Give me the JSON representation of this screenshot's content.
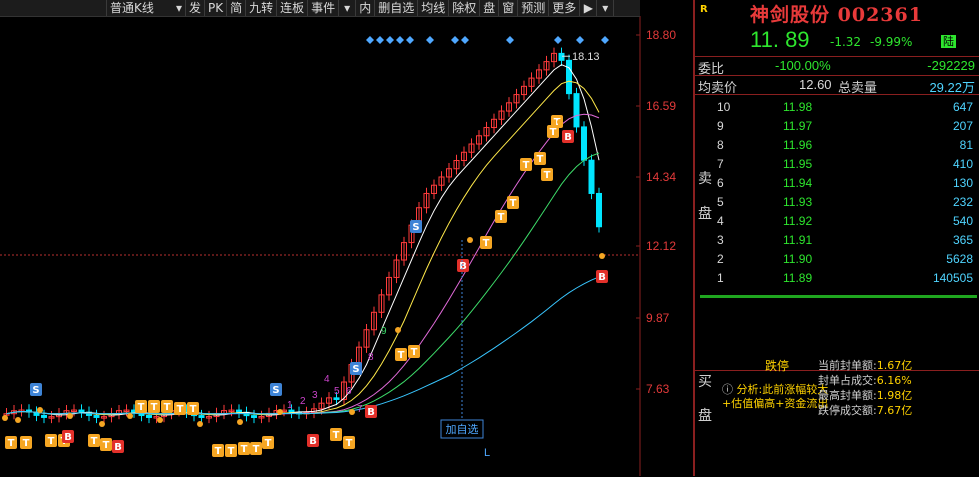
{
  "toolbar": {
    "items": [
      "普通K线",
      "发",
      "PK",
      "简",
      "九转",
      "连板",
      "事件",
      "内",
      "删自选",
      "均线",
      "除权",
      "盘",
      "窗",
      "预测",
      "更多"
    ]
  },
  "chart": {
    "y_axis_labels": [
      "18.80",
      "16.59",
      "14.34",
      "12.12",
      "9.87",
      "7.63"
    ],
    "peak_label": "18.13",
    "add_watchlist_label": "加自选",
    "l_marker": "L",
    "count_labels": [
      "1",
      "2",
      "3",
      "4",
      "5",
      "6",
      "7",
      "8",
      "9"
    ],
    "signal_t": "T",
    "signal_b": "B",
    "signal_s": "S",
    "colors": {
      "up": "#ff3b3b",
      "down": "#00e5ff",
      "ma5": "#ffffff",
      "ma10": "#ffe94a",
      "ma20": "#e06ad8",
      "ma30": "#3ddc6a",
      "ma60": "#39c6ff"
    }
  },
  "quote": {
    "badge": "R",
    "name": "神剑股份",
    "code": "002361",
    "price": "11. 89",
    "change": "-1.32",
    "change_pct": "-9.99%",
    "market_tag": "陆",
    "weibi_label": "委比",
    "weibi_pct": "-100.00%",
    "weibi_val": "-292229",
    "avg_label": "均卖价",
    "avg_val": "12.60",
    "total_label": "总卖量",
    "total_val": "29.22万"
  },
  "order_book": {
    "sell_label_1": "卖",
    "sell_label_2": "盘",
    "buy_label_1": "买",
    "buy_label_2": "盘",
    "sells": [
      {
        "level": "10",
        "price": "11.98",
        "vol": "647"
      },
      {
        "level": "9",
        "price": "11.97",
        "vol": "207"
      },
      {
        "level": "8",
        "price": "11.96",
        "vol": "81"
      },
      {
        "level": "7",
        "price": "11.95",
        "vol": "410"
      },
      {
        "level": "6",
        "price": "11.94",
        "vol": "130"
      },
      {
        "level": "5",
        "price": "11.93",
        "vol": "232"
      },
      {
        "level": "4",
        "price": "11.92",
        "vol": "540"
      },
      {
        "level": "3",
        "price": "11.91",
        "vol": "365"
      },
      {
        "level": "2",
        "price": "11.90",
        "vol": "5628"
      },
      {
        "level": "1",
        "price": "11.89",
        "vol": "140505"
      }
    ]
  },
  "limit_panel": {
    "title": "跌停",
    "analysis": "分析:此前涨幅较大+估值偏高+资金流出",
    "stats": [
      {
        "label": "当前封单额:",
        "value": "1.67亿"
      },
      {
        "label": "封单占成交:",
        "value": "6.16%"
      },
      {
        "label": "最高封单额:",
        "value": "1.98亿"
      },
      {
        "label": "跌停成交额:",
        "value": "7.67亿"
      }
    ]
  }
}
